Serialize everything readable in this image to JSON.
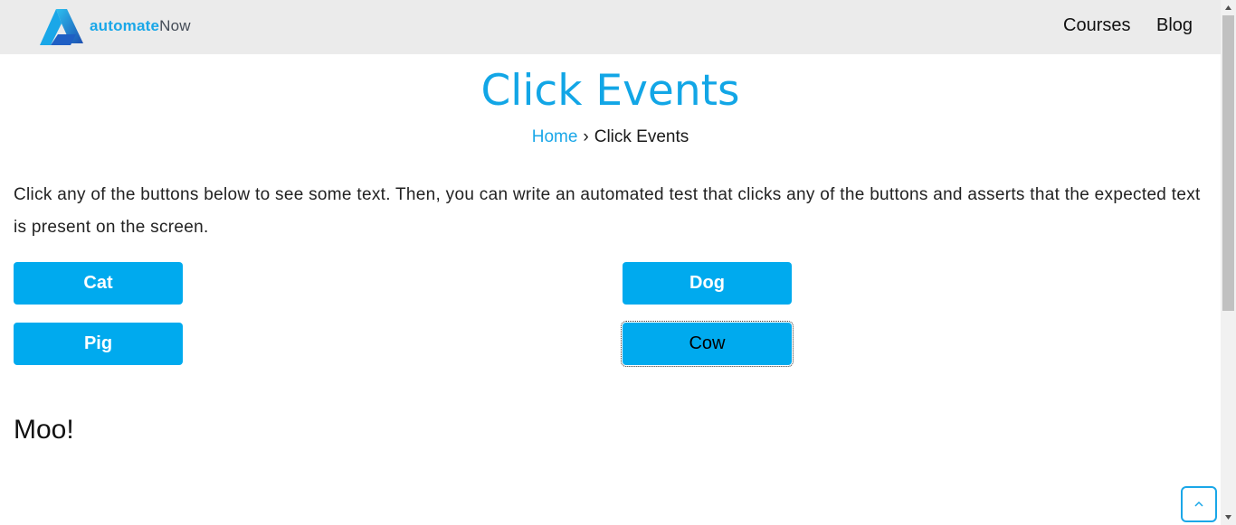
{
  "header": {
    "brand_part1": "automate",
    "brand_part2": "Now",
    "nav": [
      "Courses",
      "Blog"
    ]
  },
  "page": {
    "title": "Click Events",
    "breadcrumb": {
      "home": "Home",
      "separator": "›",
      "current": "Click Events"
    },
    "intro": "Click any of the buttons below to see some text. Then, you can write an automated test that clicks any of the buttons and asserts that the expected text is present on the screen."
  },
  "buttons": {
    "cat": "Cat",
    "dog": "Dog",
    "pig": "Pig",
    "cow": "Cow"
  },
  "result_text": "Moo!",
  "colors": {
    "accent": "#12a6e6",
    "button": "#00aaee",
    "header_bg": "#ebebeb"
  },
  "icons": {
    "logo": "automatenow-logo",
    "back_to_top": "chevron-up-icon"
  }
}
